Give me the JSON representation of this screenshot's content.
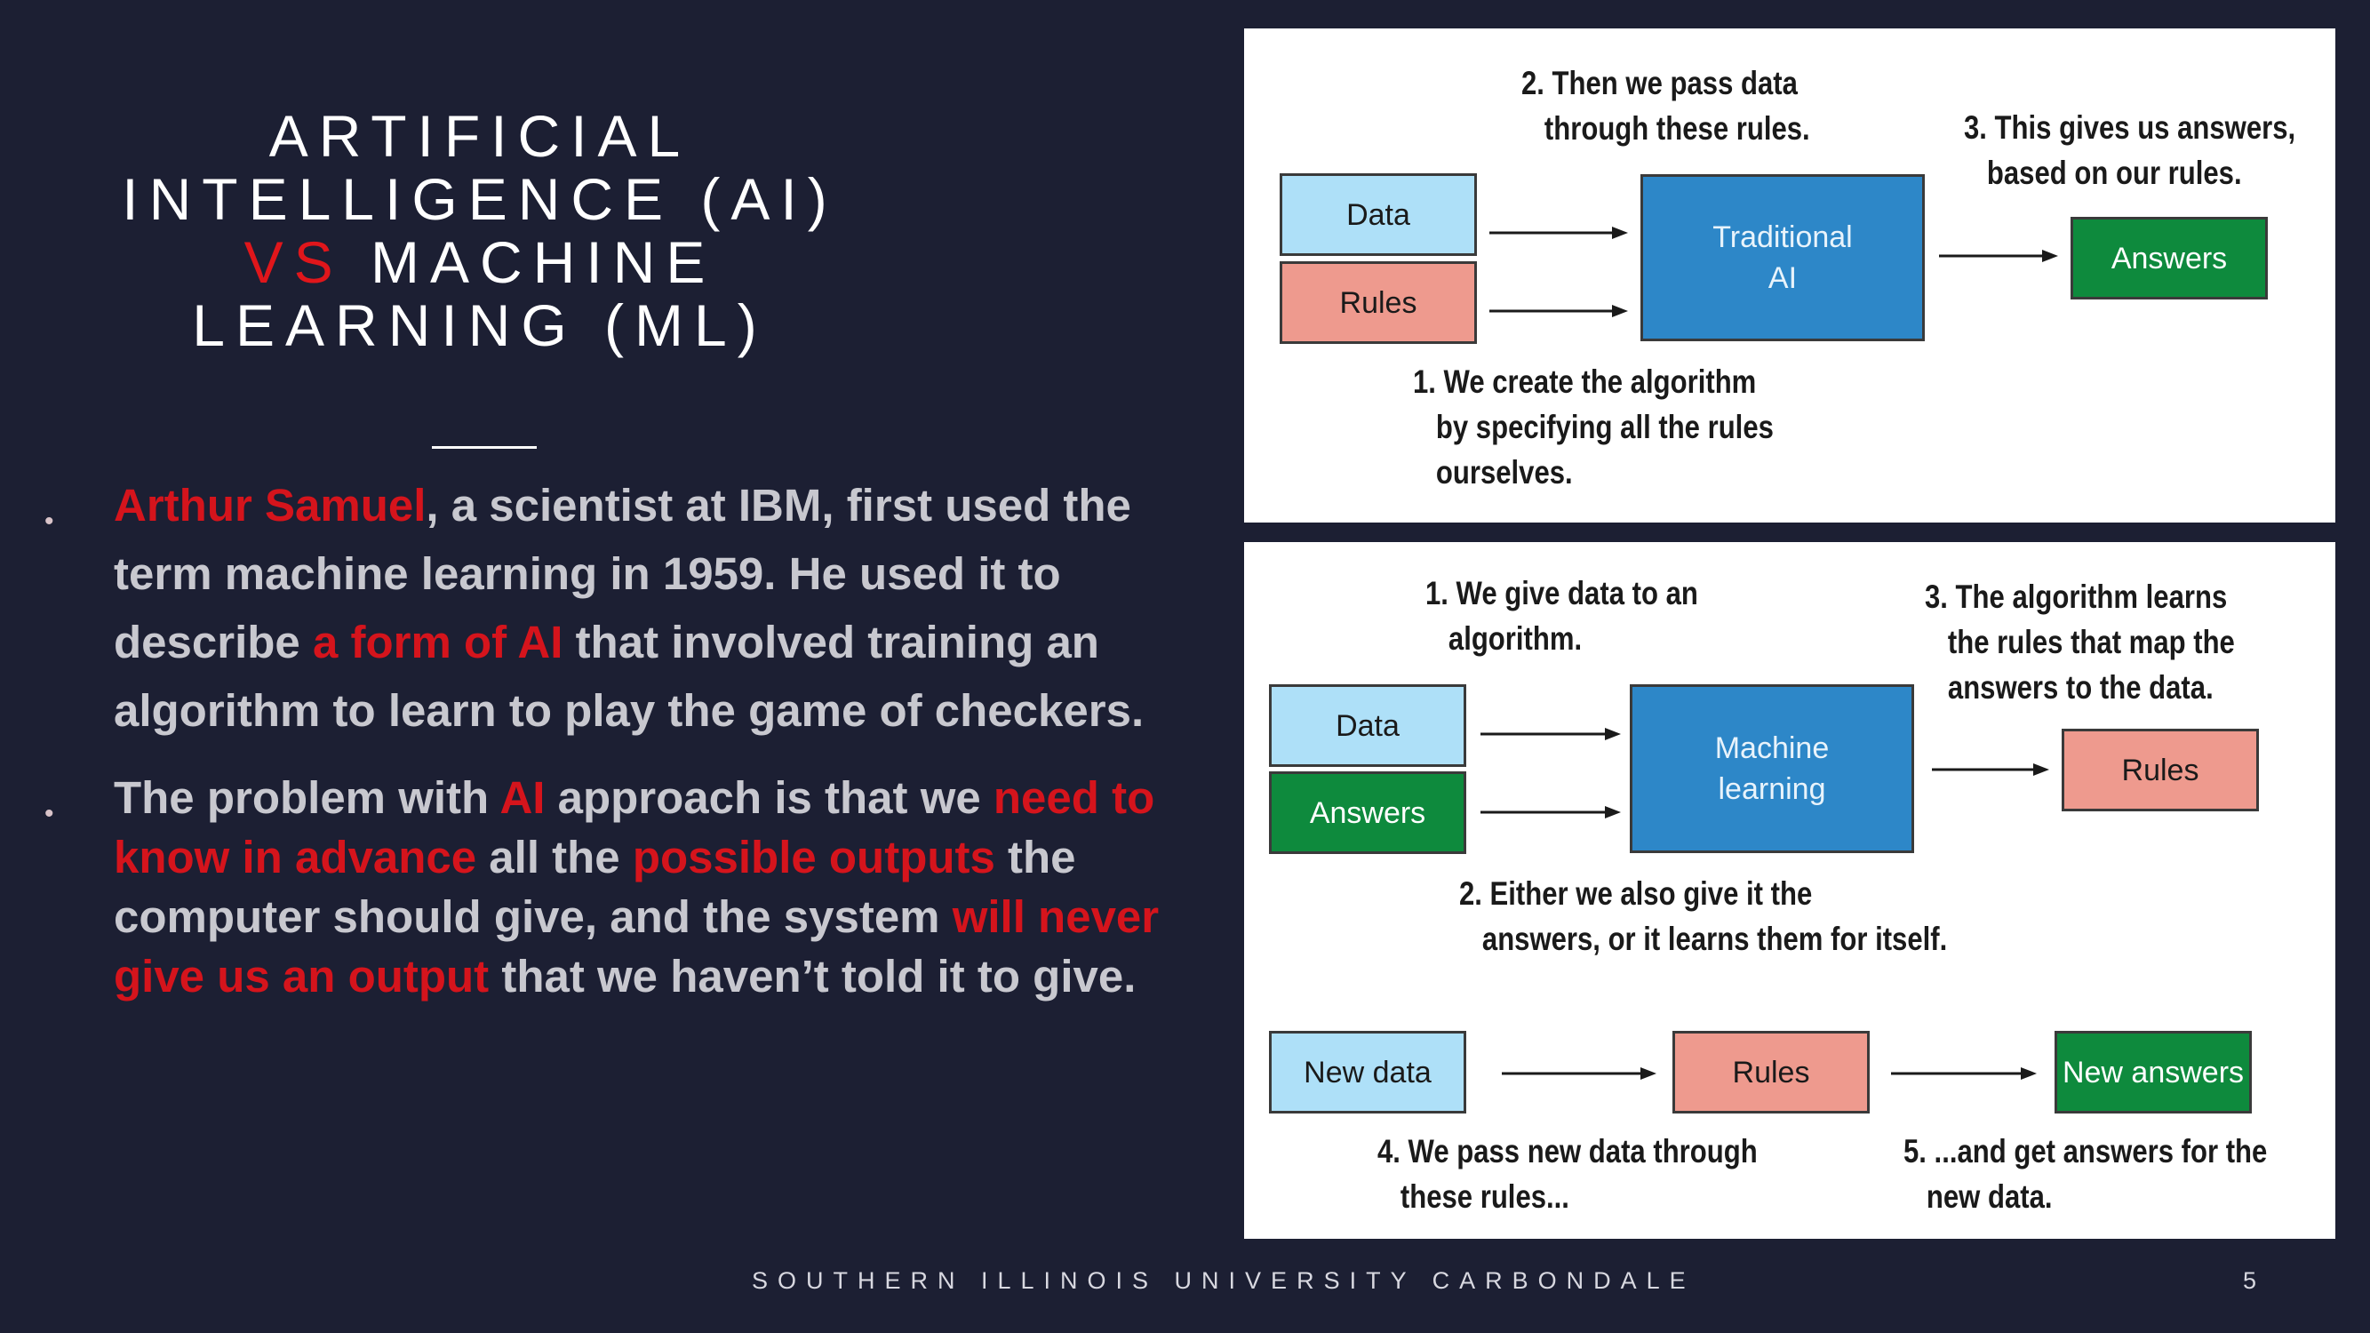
{
  "slide": {
    "title": {
      "line1": "ARTIFICIAL",
      "line2": "INTELLIGENCE (AI)",
      "line3_vs": "VS",
      "line3_rest": " MACHINE",
      "line4": "LEARNING (ML)"
    },
    "bullet_marker": "•",
    "bullet1": {
      "p1": "Arthur Samuel",
      "p2": ", a scientist at IBM, first used the term machine learning in 1959. He used it to describe ",
      "p3": "a form of AI",
      "p4": " that involved training an algorithm to learn to play the game of checkers."
    },
    "bullet2": {
      "p1": "The problem with ",
      "p2": "AI",
      "p3": " approach is that we ",
      "p4": "need to know in advance",
      "p5": " all the ",
      "p6": "possible outputs",
      "p7": " the computer should give, and the system ",
      "p8": "will never give us an output",
      "p9": " that we haven’t told it to give."
    },
    "footer": "SOUTHERN ILLINOIS UNIVERSITY CARBONDALE",
    "page_number": "5"
  },
  "diagram_traditional": {
    "note_pass": "2. Then we pass data\n   through these rules.",
    "note_answers": "3. This gives us answers,\n   based on our rules.",
    "note_create": "1. We create the algorithm\n   by specifying all the rules\n   ourselves.",
    "box_data": "Data",
    "box_rules": "Rules",
    "box_traditional_l1": "Traditional",
    "box_traditional_l2": "AI",
    "box_answers": "Answers"
  },
  "diagram_ml": {
    "note_give": "1. We give data to an\n   algorithm.",
    "note_learns": "3. The algorithm learns\n   the rules that map the\n   answers to the data.",
    "note_either": "2. Either we also give it the\n   answers, or it learns them for itself.",
    "note_pass_new": "4. We pass new data through\n   these rules...",
    "note_get": "5. ...and get answers for the\n   new data.",
    "box_data": "Data",
    "box_answers": "Answers",
    "box_ml_l1": "Machine",
    "box_ml_l2": "learning",
    "box_rules": "Rules",
    "box_new_data": "New data",
    "box_rules2": "Rules",
    "box_new_answers": "New answers"
  },
  "colors": {
    "background": "#1c1f33",
    "accent_red": "#d5141c",
    "light_blue": "#aee0f8",
    "salmon": "#ee9a8e",
    "blue": "#2d87c8",
    "green": "#0e8a3d"
  }
}
